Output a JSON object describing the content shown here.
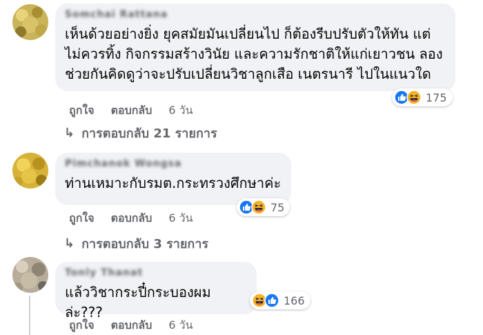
{
  "comments": [
    {
      "author": "Somchai Rattana",
      "text": "เห็นด้วยอย่างยิ่ง ยุคสมัยมันเปลี่ยนไป ก็ต้องรีบปรับตัวให้ทัน แต่ไม่ควรทิ้ง กิจกรรมสร้างวินัย และความรักชาติให้แก่เยาวชน ลองช่วยกันคิดดูว่าจะปรับเปลี่ยนวิชาลูกเสือ เนตรนารี ไปในแนวใด",
      "reactions": [
        "like-icon",
        "haha-icon"
      ],
      "reaction_count": "175",
      "like_label": "ถูกใจ",
      "reply_label": "ตอบกลับ",
      "time": "6 วัน",
      "replies_label": "การตอบกลับ 21 รายการ"
    },
    {
      "author": "Pimchanok Wongsa",
      "text": "ท่านเหมาะกับรมต.กระทรวงศึกษาค่ะ",
      "reactions": [
        "like-icon",
        "haha-icon"
      ],
      "reaction_count": "75",
      "like_label": "ถูกใจ",
      "reply_label": "ตอบกลับ",
      "time": "6 วัน",
      "replies_label": "การตอบกลับ 3 รายการ"
    },
    {
      "author": "Tonly Thanat",
      "text": "แล้ววิชากระปี๋กระบองผมล่ะ???",
      "reactions": [
        "haha-icon",
        "like-icon"
      ],
      "reaction_count": "166",
      "like_label": "ถูกใจ",
      "reply_label": "ตอบกลับ",
      "time": "6 วัน"
    }
  ],
  "colors": {
    "bubble": "#f0f2f5",
    "meta_text": "#65676b",
    "like_blue": "#1877f2",
    "haha_yellow": "#f7b125"
  }
}
